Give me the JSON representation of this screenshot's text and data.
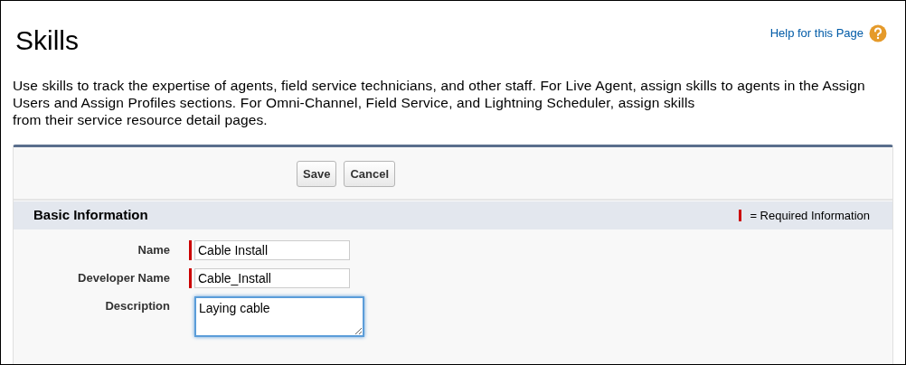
{
  "page": {
    "title": "Skills",
    "help_link": "Help for this Page",
    "description": "Use skills to track the expertise of agents, field service technicians, and other staff. For Live Agent, assign skills to agents in the Assign Users and Assign Profiles sections. For Omni-Channel, Field Service, and Lightning Scheduler, assign skills\nfrom their service resource detail pages."
  },
  "buttons": [
    "Save",
    "Cancel"
  ],
  "section": {
    "title": "Basic Information",
    "legend": "= Required Information"
  },
  "fields": [
    {
      "label": "Name",
      "kind": "text",
      "value": "Cable Install",
      "required": true,
      "focused": false
    },
    {
      "label": "Developer Name",
      "kind": "text",
      "value": "Cable_Install",
      "required": true,
      "focused": false
    },
    {
      "label": "Description",
      "kind": "textarea",
      "value": "Laying cable",
      "required": false,
      "focused": true
    }
  ]
}
